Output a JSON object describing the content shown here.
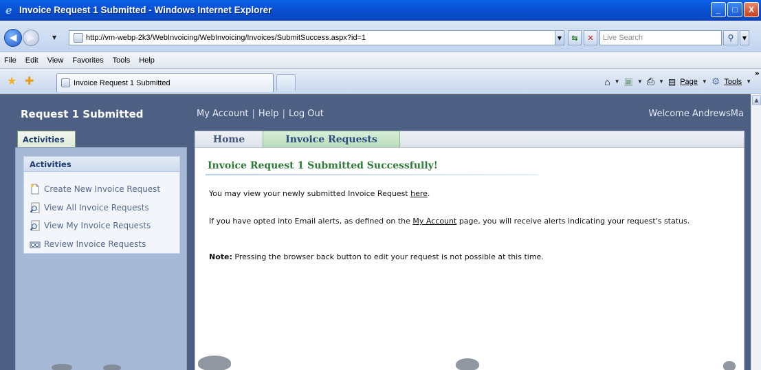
{
  "window": {
    "title": "Invoice Request 1 Submitted - Windows Internet Explorer",
    "buttons": [
      "_",
      "□",
      "X"
    ]
  },
  "addressbar": {
    "url": "http://vm-webp-2k3/WebInvoicing/WebInvoicing/Invoices/SubmitSuccess.aspx?id=1",
    "search_placeholder": "Live Search"
  },
  "menu": {
    "items": [
      "File",
      "Edit",
      "View",
      "Favorites",
      "Tools",
      "Help"
    ]
  },
  "tabs": {
    "active_label": "Invoice Request 1 Submitted"
  },
  "commandbar": {
    "page_label": "Page",
    "tools_label": "Tools"
  },
  "site": {
    "title": "Request 1 Submitted",
    "links": [
      "My Account",
      "Help",
      "Log Out"
    ],
    "welcome": "Welcome AndrewsMa"
  },
  "sidebar": {
    "tab_label": "Activities",
    "box_title": "Activities",
    "items": [
      {
        "label": "Create New Invoice Request",
        "icon": "new-document-icon"
      },
      {
        "label": "View All Invoice Requests",
        "icon": "magnifier-icon"
      },
      {
        "label": "View My Invoice Requests",
        "icon": "magnifier-icon"
      },
      {
        "label": "Review Invoice Requests",
        "icon": "review-icon"
      }
    ]
  },
  "main": {
    "tabs": [
      "Home",
      "Invoice Requests"
    ],
    "heading": "Invoice Request 1 Submitted Successfully!",
    "p1_before": "You may view your newly submitted Invoice Request ",
    "p1_link": "here",
    "p1_after": ".",
    "p2_before": "If you have opted into Email alerts, as defined on the ",
    "p2_link": "My Account",
    "p2_after": " page, you will receive alerts indicating your request's status.",
    "p3_bold": "Note:",
    "p3_text": " Pressing the browser back button to edit your request is not possible at this time."
  },
  "colors": {
    "page_bg": "#4d6083",
    "heading_green": "#2d7b37",
    "link_blue": "#55698e"
  }
}
